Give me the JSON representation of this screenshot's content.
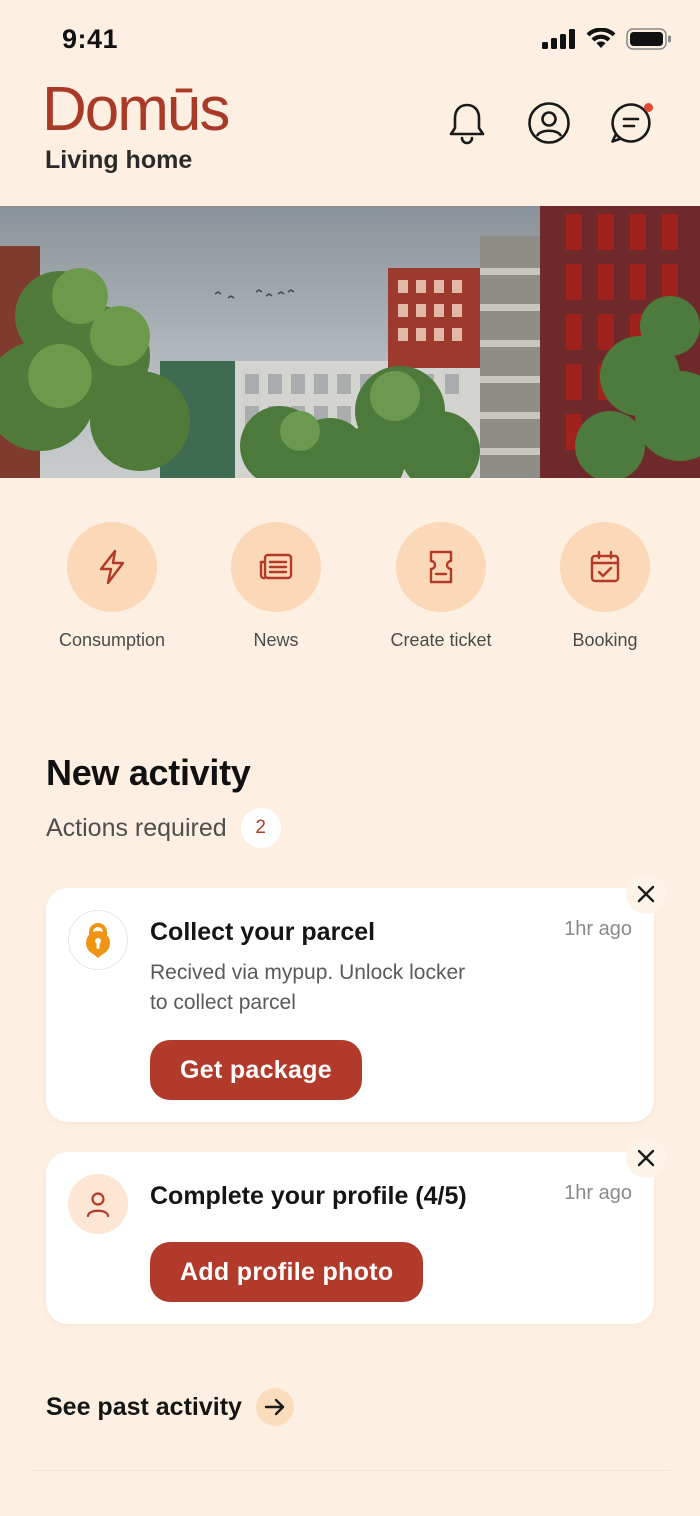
{
  "status_bar": {
    "time": "9:41"
  },
  "brand": {
    "logo": "Domūs",
    "tagline": "Living home",
    "color": "#A93A27"
  },
  "header_icons": [
    "bell-icon",
    "profile-icon",
    "chat-icon"
  ],
  "quick_actions": [
    {
      "label": "Consumption",
      "icon": "lightning-icon"
    },
    {
      "label": "News",
      "icon": "newspaper-icon"
    },
    {
      "label": "Create ticket",
      "icon": "ticket-icon"
    },
    {
      "label": "Booking",
      "icon": "calendar-icon"
    }
  ],
  "activity": {
    "title": "New activity",
    "subtitle": "Actions required",
    "count": "2",
    "cards": [
      {
        "title": "Collect your parcel",
        "time": "1hr ago",
        "description": "Recived via mypup. Unlock locker to collect parcel",
        "button": "Get package",
        "icon": "lock-icon"
      },
      {
        "title": "Complete your profile (4/5)",
        "time": "1hr ago",
        "button": "Add profile photo",
        "icon": "user-icon"
      }
    ]
  },
  "past_activity": {
    "label": "See past activity"
  },
  "colors": {
    "background": "#FDF0E2",
    "accent": "#B23A2A",
    "icon_circle": "#FAD8B8"
  }
}
